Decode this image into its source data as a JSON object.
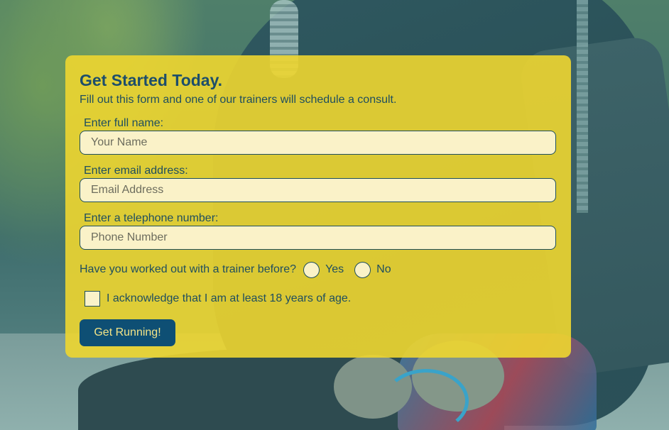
{
  "form": {
    "title": "Get Started Today.",
    "subtitle": "Fill out this form and one of our trainers will schedule a consult.",
    "name": {
      "label": "Enter full name:",
      "placeholder": "Your Name",
      "value": ""
    },
    "email": {
      "label": "Enter email address:",
      "placeholder": "Email Address",
      "value": ""
    },
    "phone": {
      "label": "Enter a telephone number:",
      "placeholder": "Phone Number",
      "value": ""
    },
    "trainer_question": {
      "label": "Have you worked out with a trainer before?",
      "options": [
        "Yes",
        "No"
      ],
      "selected": null
    },
    "age_acknowledgement": {
      "label": "I acknowledge that I am at least 18 years of age.",
      "checked": false
    },
    "submit_label": "Get Running!"
  },
  "colors": {
    "card_background": "#EED630",
    "title": "#1D4E6B",
    "button_background": "#0E4F74",
    "button_text": "#F3E487",
    "field_background": "#FAF2C8"
  }
}
